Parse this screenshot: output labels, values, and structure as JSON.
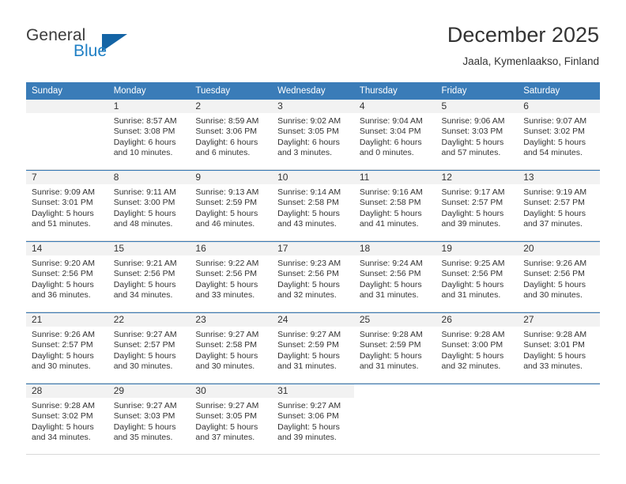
{
  "brand": {
    "name_top": "General",
    "name_bottom": "Blue",
    "triangle_icon": "triangle-icon",
    "color_dark": "#3c3c3c",
    "color_blue": "#1f7fc4",
    "triangle_color": "#1464a5"
  },
  "header": {
    "title": "December 2025",
    "subtitle": "Jaala, Kymenlaakso, Finland"
  },
  "theme": {
    "header_row_bg": "#3a7cb8",
    "header_row_text": "#ffffff",
    "daynum_bg": "#f2f2f2",
    "text": "#333333",
    "row_divider": "#3a7cb8"
  },
  "weekdays": [
    "Sunday",
    "Monday",
    "Tuesday",
    "Wednesday",
    "Thursday",
    "Friday",
    "Saturday"
  ],
  "calendar": {
    "weeks": [
      [
        {
          "day": "",
          "sunrise": "",
          "sunset": "",
          "daylight_line1": "",
          "daylight_line2": ""
        },
        {
          "day": "1",
          "sunrise": "Sunrise: 8:57 AM",
          "sunset": "Sunset: 3:08 PM",
          "daylight_line1": "Daylight: 6 hours",
          "daylight_line2": "and 10 minutes."
        },
        {
          "day": "2",
          "sunrise": "Sunrise: 8:59 AM",
          "sunset": "Sunset: 3:06 PM",
          "daylight_line1": "Daylight: 6 hours",
          "daylight_line2": "and 6 minutes."
        },
        {
          "day": "3",
          "sunrise": "Sunrise: 9:02 AM",
          "sunset": "Sunset: 3:05 PM",
          "daylight_line1": "Daylight: 6 hours",
          "daylight_line2": "and 3 minutes."
        },
        {
          "day": "4",
          "sunrise": "Sunrise: 9:04 AM",
          "sunset": "Sunset: 3:04 PM",
          "daylight_line1": "Daylight: 6 hours",
          "daylight_line2": "and 0 minutes."
        },
        {
          "day": "5",
          "sunrise": "Sunrise: 9:06 AM",
          "sunset": "Sunset: 3:03 PM",
          "daylight_line1": "Daylight: 5 hours",
          "daylight_line2": "and 57 minutes."
        },
        {
          "day": "6",
          "sunrise": "Sunrise: 9:07 AM",
          "sunset": "Sunset: 3:02 PM",
          "daylight_line1": "Daylight: 5 hours",
          "daylight_line2": "and 54 minutes."
        }
      ],
      [
        {
          "day": "7",
          "sunrise": "Sunrise: 9:09 AM",
          "sunset": "Sunset: 3:01 PM",
          "daylight_line1": "Daylight: 5 hours",
          "daylight_line2": "and 51 minutes."
        },
        {
          "day": "8",
          "sunrise": "Sunrise: 9:11 AM",
          "sunset": "Sunset: 3:00 PM",
          "daylight_line1": "Daylight: 5 hours",
          "daylight_line2": "and 48 minutes."
        },
        {
          "day": "9",
          "sunrise": "Sunrise: 9:13 AM",
          "sunset": "Sunset: 2:59 PM",
          "daylight_line1": "Daylight: 5 hours",
          "daylight_line2": "and 46 minutes."
        },
        {
          "day": "10",
          "sunrise": "Sunrise: 9:14 AM",
          "sunset": "Sunset: 2:58 PM",
          "daylight_line1": "Daylight: 5 hours",
          "daylight_line2": "and 43 minutes."
        },
        {
          "day": "11",
          "sunrise": "Sunrise: 9:16 AM",
          "sunset": "Sunset: 2:58 PM",
          "daylight_line1": "Daylight: 5 hours",
          "daylight_line2": "and 41 minutes."
        },
        {
          "day": "12",
          "sunrise": "Sunrise: 9:17 AM",
          "sunset": "Sunset: 2:57 PM",
          "daylight_line1": "Daylight: 5 hours",
          "daylight_line2": "and 39 minutes."
        },
        {
          "day": "13",
          "sunrise": "Sunrise: 9:19 AM",
          "sunset": "Sunset: 2:57 PM",
          "daylight_line1": "Daylight: 5 hours",
          "daylight_line2": "and 37 minutes."
        }
      ],
      [
        {
          "day": "14",
          "sunrise": "Sunrise: 9:20 AM",
          "sunset": "Sunset: 2:56 PM",
          "daylight_line1": "Daylight: 5 hours",
          "daylight_line2": "and 36 minutes."
        },
        {
          "day": "15",
          "sunrise": "Sunrise: 9:21 AM",
          "sunset": "Sunset: 2:56 PM",
          "daylight_line1": "Daylight: 5 hours",
          "daylight_line2": "and 34 minutes."
        },
        {
          "day": "16",
          "sunrise": "Sunrise: 9:22 AM",
          "sunset": "Sunset: 2:56 PM",
          "daylight_line1": "Daylight: 5 hours",
          "daylight_line2": "and 33 minutes."
        },
        {
          "day": "17",
          "sunrise": "Sunrise: 9:23 AM",
          "sunset": "Sunset: 2:56 PM",
          "daylight_line1": "Daylight: 5 hours",
          "daylight_line2": "and 32 minutes."
        },
        {
          "day": "18",
          "sunrise": "Sunrise: 9:24 AM",
          "sunset": "Sunset: 2:56 PM",
          "daylight_line1": "Daylight: 5 hours",
          "daylight_line2": "and 31 minutes."
        },
        {
          "day": "19",
          "sunrise": "Sunrise: 9:25 AM",
          "sunset": "Sunset: 2:56 PM",
          "daylight_line1": "Daylight: 5 hours",
          "daylight_line2": "and 31 minutes."
        },
        {
          "day": "20",
          "sunrise": "Sunrise: 9:26 AM",
          "sunset": "Sunset: 2:56 PM",
          "daylight_line1": "Daylight: 5 hours",
          "daylight_line2": "and 30 minutes."
        }
      ],
      [
        {
          "day": "21",
          "sunrise": "Sunrise: 9:26 AM",
          "sunset": "Sunset: 2:57 PM",
          "daylight_line1": "Daylight: 5 hours",
          "daylight_line2": "and 30 minutes."
        },
        {
          "day": "22",
          "sunrise": "Sunrise: 9:27 AM",
          "sunset": "Sunset: 2:57 PM",
          "daylight_line1": "Daylight: 5 hours",
          "daylight_line2": "and 30 minutes."
        },
        {
          "day": "23",
          "sunrise": "Sunrise: 9:27 AM",
          "sunset": "Sunset: 2:58 PM",
          "daylight_line1": "Daylight: 5 hours",
          "daylight_line2": "and 30 minutes."
        },
        {
          "day": "24",
          "sunrise": "Sunrise: 9:27 AM",
          "sunset": "Sunset: 2:59 PM",
          "daylight_line1": "Daylight: 5 hours",
          "daylight_line2": "and 31 minutes."
        },
        {
          "day": "25",
          "sunrise": "Sunrise: 9:28 AM",
          "sunset": "Sunset: 2:59 PM",
          "daylight_line1": "Daylight: 5 hours",
          "daylight_line2": "and 31 minutes."
        },
        {
          "day": "26",
          "sunrise": "Sunrise: 9:28 AM",
          "sunset": "Sunset: 3:00 PM",
          "daylight_line1": "Daylight: 5 hours",
          "daylight_line2": "and 32 minutes."
        },
        {
          "day": "27",
          "sunrise": "Sunrise: 9:28 AM",
          "sunset": "Sunset: 3:01 PM",
          "daylight_line1": "Daylight: 5 hours",
          "daylight_line2": "and 33 minutes."
        }
      ],
      [
        {
          "day": "28",
          "sunrise": "Sunrise: 9:28 AM",
          "sunset": "Sunset: 3:02 PM",
          "daylight_line1": "Daylight: 5 hours",
          "daylight_line2": "and 34 minutes."
        },
        {
          "day": "29",
          "sunrise": "Sunrise: 9:27 AM",
          "sunset": "Sunset: 3:03 PM",
          "daylight_line1": "Daylight: 5 hours",
          "daylight_line2": "and 35 minutes."
        },
        {
          "day": "30",
          "sunrise": "Sunrise: 9:27 AM",
          "sunset": "Sunset: 3:05 PM",
          "daylight_line1": "Daylight: 5 hours",
          "daylight_line2": "and 37 minutes."
        },
        {
          "day": "31",
          "sunrise": "Sunrise: 9:27 AM",
          "sunset": "Sunset: 3:06 PM",
          "daylight_line1": "Daylight: 5 hours",
          "daylight_line2": "and 39 minutes."
        },
        {
          "day": "",
          "sunrise": "",
          "sunset": "",
          "daylight_line1": "",
          "daylight_line2": ""
        },
        {
          "day": "",
          "sunrise": "",
          "sunset": "",
          "daylight_line1": "",
          "daylight_line2": ""
        },
        {
          "day": "",
          "sunrise": "",
          "sunset": "",
          "daylight_line1": "",
          "daylight_line2": ""
        }
      ]
    ]
  }
}
